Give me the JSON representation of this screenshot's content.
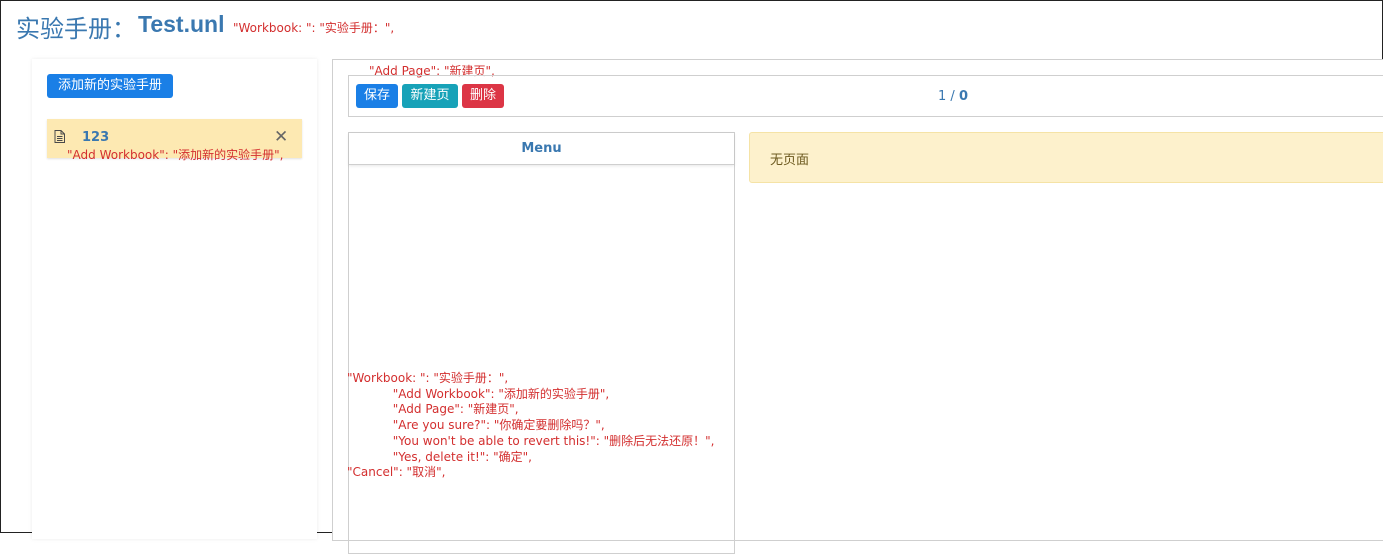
{
  "header": {
    "title": "实验手册：",
    "file_name": "Test.unl",
    "debug_text": "\"Workbook: \": \"实验手册：\","
  },
  "sidebar": {
    "add_workbook_label": "添加新的实验手册",
    "workbooks": [
      {
        "name": "123",
        "icon": "document-icon",
        "close_glyph": "✕"
      }
    ],
    "debug_text": "\"Add Workbook\": \"添加新的实验手册\","
  },
  "main": {
    "debug_add_page": "\"Add Page\": \"新建页\",",
    "toolbar": {
      "save_label": "保存",
      "new_page_label": "新建页",
      "delete_label": "删除",
      "page_current": "1",
      "page_separator": "/",
      "page_total": "0"
    },
    "menu": {
      "title": "Menu",
      "debug_lines": "\"Workbook: \": \"实验手册：\",\n            \"Add Workbook\": \"添加新的实验手册\",\n            \"Add Page\": \"新建页\",\n            \"Are you sure?\": \"你确定要删除吗？\",\n            \"You won't be able to revert this!\": \"删除后无法还原！\",\n            \"Yes, delete it!\": \"确定\",\n\"Cancel\": \"取消\","
    },
    "no_page_text": "无页面"
  },
  "colors": {
    "primary": "#1a7fe6",
    "info": "#17a2b8",
    "danger": "#dc3545",
    "warning_bg": "#fde9b2",
    "debug_text": "#d32f2f",
    "title_blue": "#3a78b0"
  }
}
